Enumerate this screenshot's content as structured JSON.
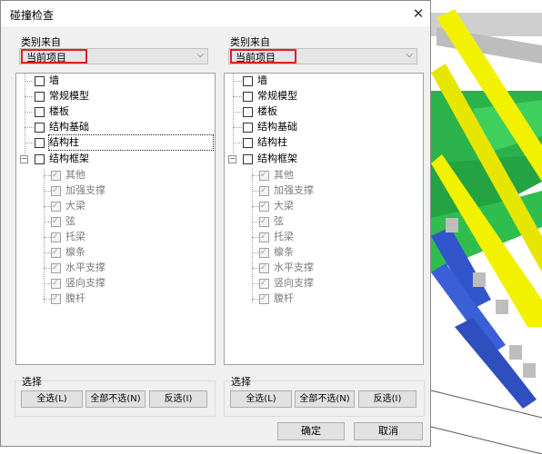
{
  "dialog": {
    "title": "碰撞检查",
    "close_glyph": "✕"
  },
  "left": {
    "category_label": "类别来自",
    "category_value": "当前项目",
    "dropdown_glyph": "⌵",
    "items": [
      "墙",
      "常规模型",
      "楼板",
      "结构基础",
      "结构柱",
      "结构框架"
    ],
    "sub_items": [
      "其他",
      "加强支撑",
      "大梁",
      "弦",
      "托梁",
      "檩条",
      "水平支撑",
      "竖向支撑",
      "腹杆"
    ],
    "select_group": "选择",
    "btn_all": "全选(L)",
    "btn_none": "全部不选(N)",
    "btn_invert": "反选(I)"
  },
  "right": {
    "category_label": "类别来自",
    "category_value": "当前项目",
    "dropdown_glyph": "⌵",
    "items": [
      "墙",
      "常规模型",
      "楼板",
      "结构基础",
      "结构柱",
      "结构框架"
    ],
    "sub_items": [
      "其他",
      "加强支撑",
      "大梁",
      "弦",
      "托梁",
      "檩条",
      "水平支撑",
      "竖向支撑",
      "腹杆"
    ],
    "select_group": "选择",
    "btn_all": "全选(L)",
    "btn_none": "全部不选(N)",
    "btn_invert": "反选(I)"
  },
  "footer": {
    "ok": "确定",
    "cancel": "取消"
  },
  "colors": {
    "highlight_border": "#e02020",
    "beam_yellow": "#f2f200",
    "slab_green": "#2cb24a",
    "member_blue": "#3355cc"
  },
  "tree_expander_glyph": "−"
}
